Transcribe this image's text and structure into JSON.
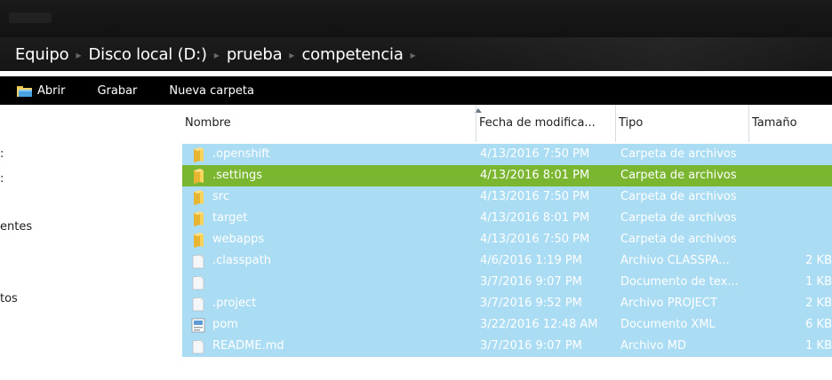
{
  "breadcrumb": [
    "Equipo",
    "Disco local (D:)",
    "prueba",
    "competencia"
  ],
  "toolbar": {
    "open_label": "Abrir",
    "record_label": "Grabar",
    "new_folder_label": "Nueva carpeta"
  },
  "nav_pane": {
    "items": [
      {
        "label": ":"
      },
      {
        "label": ":"
      },
      {
        "label": "entes"
      },
      {
        "label": "tos"
      }
    ]
  },
  "columns": {
    "name": "Nombre",
    "date": "Fecha de modifica...",
    "type": "Tipo",
    "size": "Tamaño"
  },
  "files": [
    {
      "name": ".openshift",
      "date": "4/13/2016 7:50 PM",
      "type": "Carpeta de archivos",
      "size": "",
      "icon": "folder-icon"
    },
    {
      "name": ".settings",
      "date": "4/13/2016 8:01 PM",
      "type": "Carpeta de archivos",
      "size": "",
      "icon": "folder-icon"
    },
    {
      "name": "src",
      "date": "4/13/2016 7:50 PM",
      "type": "Carpeta de archivos",
      "size": "",
      "icon": "folder-icon"
    },
    {
      "name": "target",
      "date": "4/13/2016 8:01 PM",
      "type": "Carpeta de archivos",
      "size": "",
      "icon": "folder-icon"
    },
    {
      "name": "webapps",
      "date": "4/13/2016 7:50 PM",
      "type": "Carpeta de archivos",
      "size": "",
      "icon": "folder-icon"
    },
    {
      "name": ".classpath",
      "date": "4/6/2016 1:19 PM",
      "type": "Archivo CLASSPA...",
      "size": "2 KB",
      "icon": "file-icon"
    },
    {
      "name": "",
      "date": "3/7/2016 9:07 PM",
      "type": "Documento de tex...",
      "size": "1 KB",
      "icon": "file-icon"
    },
    {
      "name": ".project",
      "date": "3/7/2016 9:52 PM",
      "type": "Archivo PROJECT",
      "size": "2 KB",
      "icon": "file-icon"
    },
    {
      "name": "pom",
      "date": "3/22/2016 12:48 AM",
      "type": "Documento XML",
      "size": "6 KB",
      "icon": "xml-file-icon"
    },
    {
      "name": "README.md",
      "date": "3/7/2016 9:07 PM",
      "type": "Archivo MD",
      "size": "1 KB",
      "icon": "file-icon"
    }
  ],
  "colors": {
    "selection": "#aadcf3",
    "hover": "#7ab62f",
    "toolbar_bg": "#000000",
    "address_bg": "#151515"
  }
}
